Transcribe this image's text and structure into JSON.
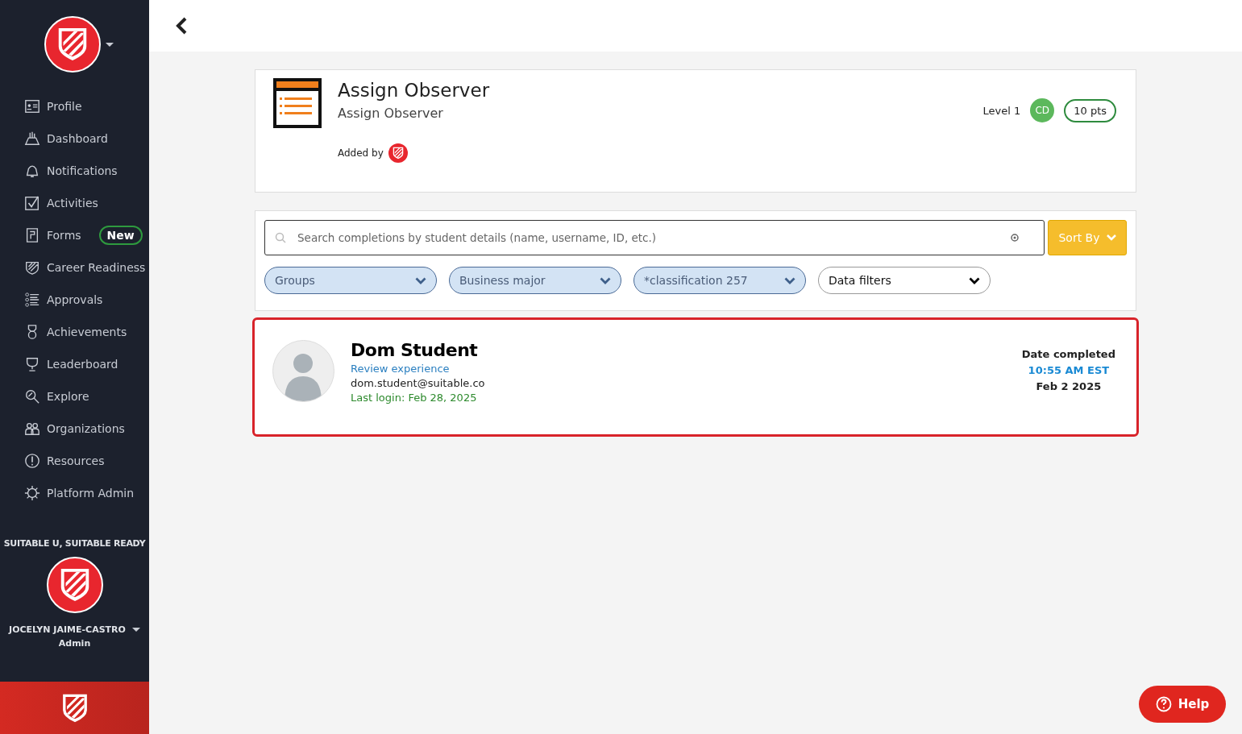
{
  "sidebar": {
    "items": [
      {
        "label": "Profile"
      },
      {
        "label": "Dashboard"
      },
      {
        "label": "Notifications"
      },
      {
        "label": "Activities"
      },
      {
        "label": "Forms",
        "badge": "New"
      },
      {
        "label": "Career Readiness"
      },
      {
        "label": "Approvals"
      },
      {
        "label": "Achievements"
      },
      {
        "label": "Leaderboard"
      },
      {
        "label": "Explore"
      },
      {
        "label": "Organizations"
      },
      {
        "label": "Resources"
      },
      {
        "label": "Platform Admin"
      }
    ],
    "organization": "SUITABLE U, SUITABLE READY",
    "user_name": "JOCELYN JAIME-CASTRO",
    "user_role": "Admin"
  },
  "task": {
    "title": "Assign Observer",
    "subtitle": "Assign Observer",
    "added_by": "Added by",
    "level": "Level 1",
    "avatar_initials": "CD",
    "points": "10 pts"
  },
  "search": {
    "placeholder": "Search completions by student details (name, username, ID, etc.)",
    "sort_label": "Sort By"
  },
  "filters": [
    {
      "label": "Groups",
      "active": true
    },
    {
      "label": "Business major",
      "active": true
    },
    {
      "label": "*classification 257",
      "active": true
    },
    {
      "label": "Data filters",
      "active": false
    }
  ],
  "completions": [
    {
      "name": "Dom Student",
      "link": "Review experience",
      "email": "dom.student@suitable.co",
      "last_login": "Last login: Feb 28, 2025",
      "date_heading": "Date completed",
      "time": "10:55 AM EST",
      "date": "Feb 2 2025",
      "selected": true
    }
  ],
  "help": {
    "label": "Help"
  }
}
